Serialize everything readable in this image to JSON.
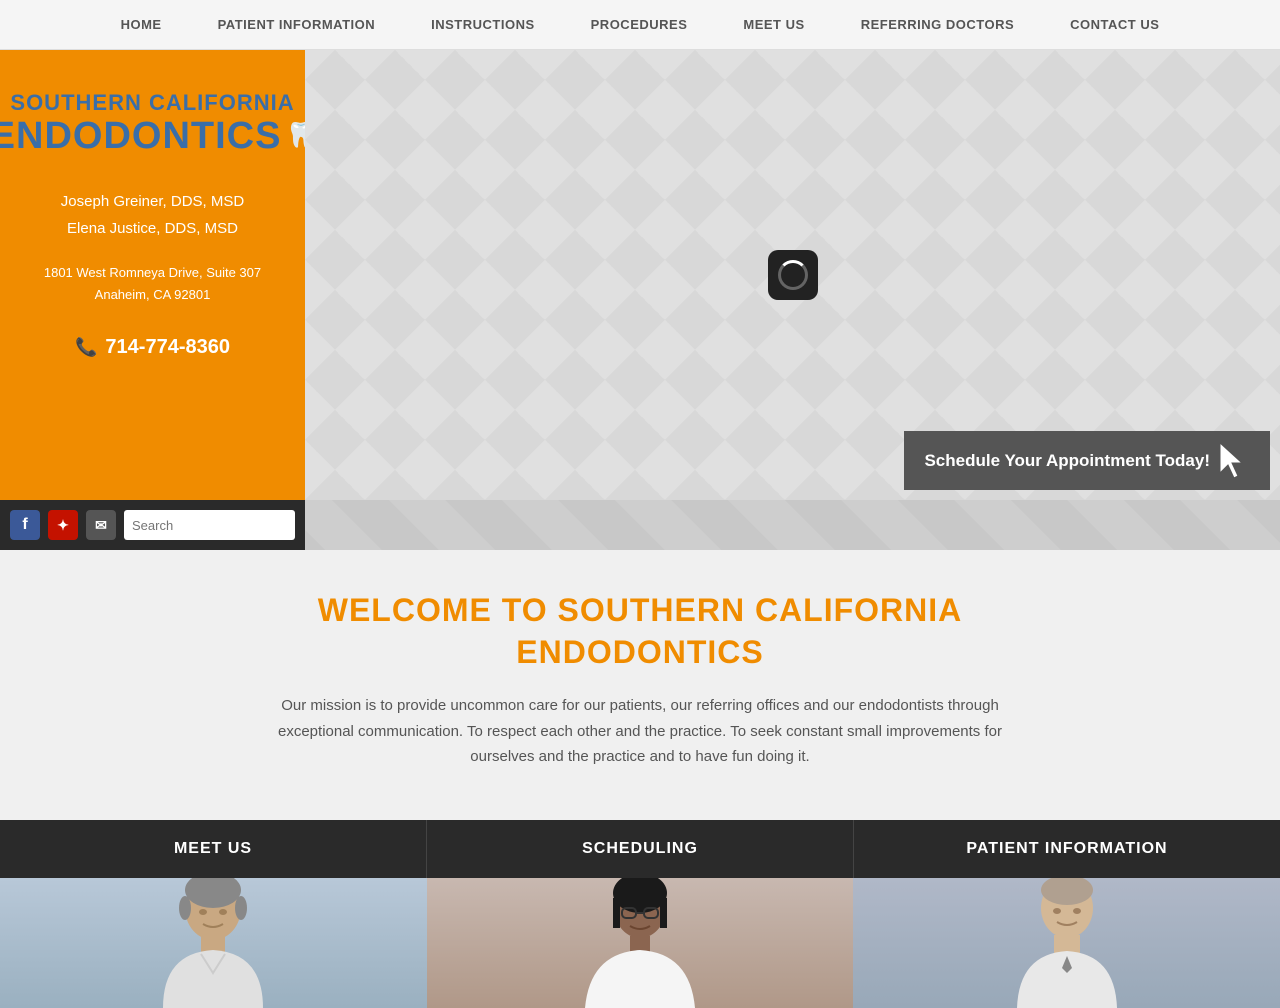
{
  "nav": {
    "items": [
      {
        "label": "HOME",
        "id": "home"
      },
      {
        "label": "PATIENT INFORMATION",
        "id": "patient-information"
      },
      {
        "label": "INSTRUCTIONS",
        "id": "instructions"
      },
      {
        "label": "PROCEDURES",
        "id": "procedures"
      },
      {
        "label": "MEET US",
        "id": "meet-us"
      },
      {
        "label": "REFERRING DOCTORS",
        "id": "referring-doctors"
      },
      {
        "label": "CONTACT US",
        "id": "contact-us"
      }
    ]
  },
  "sidebar": {
    "logo_line1": "SOUTHERN CALIFORNIA",
    "logo_line2": "ENDODONTICS",
    "doctor1": "Joseph Greiner, DDS, MSD",
    "doctor2": "Elena Justice, DDS, MSD",
    "address_line1": "1801 West Romneya Drive, Suite 307",
    "address_line2": "Anaheim, CA 92801",
    "phone": "714-774-8360"
  },
  "social": {
    "facebook_label": "f",
    "yelp_label": "★",
    "email_label": "✉"
  },
  "search": {
    "placeholder": "Search",
    "button_label": "🔍"
  },
  "hero": {
    "schedule_button": "Schedule Your Appointment Today!"
  },
  "welcome": {
    "title_line1": "WELCOME TO SOUTHERN CALIFORNIA",
    "title_line2": "ENDODONTICS",
    "body": "Our mission is to provide uncommon care for our patients, our referring offices and our endodontists through exceptional communication. To respect each other and the practice. To seek constant small improvements for ourselves and the practice and to have fun doing it."
  },
  "bottom_nav": {
    "items": [
      {
        "label": "MEET US",
        "id": "meet-us-bottom"
      },
      {
        "label": "SCHEDULING",
        "id": "scheduling-bottom"
      },
      {
        "label": "PATIENT INFORMATION",
        "id": "patient-info-bottom"
      }
    ]
  },
  "colors": {
    "orange": "#f08c00",
    "blue": "#3a6ea8",
    "dark": "#2a2a2a"
  }
}
